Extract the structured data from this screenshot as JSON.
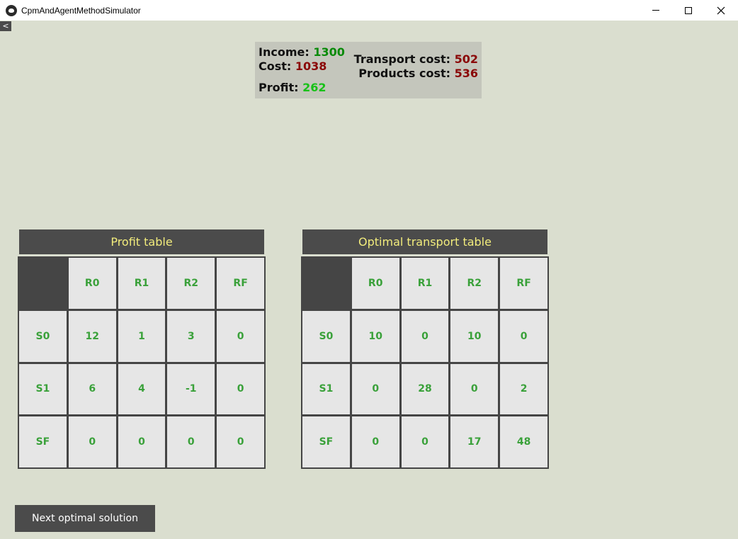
{
  "window": {
    "title": "CpmAndAgentMethodSimulator"
  },
  "back_label": "<",
  "summary": {
    "income_label": "Income:",
    "income_value": "1300",
    "cost_label": "Cost:",
    "cost_value": "1038",
    "profit_label": "Profit:",
    "profit_value": "262",
    "transport_label": "Transport cost:",
    "transport_value": "502",
    "products_label": "Products cost:",
    "products_value": "536"
  },
  "profit_table": {
    "title": "Profit table",
    "columns": [
      "R0",
      "R1",
      "R2",
      "RF"
    ],
    "rows": [
      {
        "label": "S0",
        "cells": [
          "12",
          "1",
          "3",
          "0"
        ]
      },
      {
        "label": "S1",
        "cells": [
          "6",
          "4",
          "-1",
          "0"
        ]
      },
      {
        "label": "SF",
        "cells": [
          "0",
          "0",
          "0",
          "0"
        ]
      }
    ]
  },
  "transport_table": {
    "title": "Optimal transport table",
    "columns": [
      "R0",
      "R1",
      "R2",
      "RF"
    ],
    "rows": [
      {
        "label": "S0",
        "cells": [
          "10",
          "0",
          "10",
          "0"
        ]
      },
      {
        "label": "S1",
        "cells": [
          "0",
          "28",
          "0",
          "2"
        ]
      },
      {
        "label": "SF",
        "cells": [
          "0",
          "0",
          "17",
          "48"
        ]
      }
    ]
  },
  "next_button_label": "Next optimal solution",
  "colors": {
    "background": "#dadecf",
    "income": "#078a07",
    "cost": "#8a0606",
    "profit": "#18c118",
    "table_header": "#4b4b4b",
    "table_title_text": "#f2ec7c",
    "cell_text": "#3aa13a"
  }
}
